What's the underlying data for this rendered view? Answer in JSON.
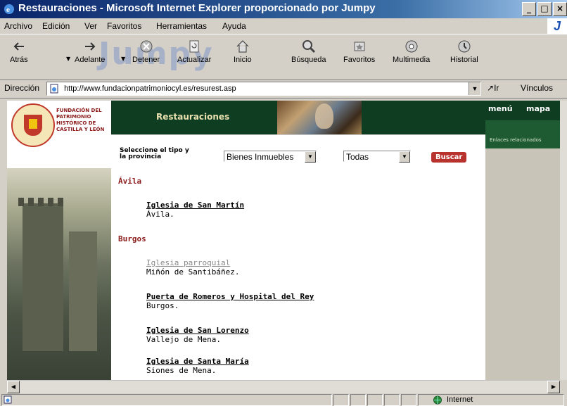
{
  "window": {
    "title": "Restauraciones - Microsoft Internet Explorer proporcionado por Jumpy"
  },
  "menu": [
    "Archivo",
    "Edición",
    "Ver",
    "Favoritos",
    "Herramientas",
    "Ayuda"
  ],
  "brand_logo": "J",
  "toolbar": {
    "watermark": "Jumpy",
    "buttons": [
      {
        "label": "Atrás",
        "icon": "back-arrow-icon"
      },
      {
        "label": "Adelante",
        "icon": "forward-arrow-icon"
      },
      {
        "label": "Detener",
        "icon": "stop-icon"
      },
      {
        "label": "Actualizar",
        "icon": "refresh-icon"
      },
      {
        "label": "Inicio",
        "icon": "home-icon"
      },
      {
        "label": "Búsqueda",
        "icon": "search-icon"
      },
      {
        "label": "Favoritos",
        "icon": "favorites-icon"
      },
      {
        "label": "Multimedia",
        "icon": "media-icon"
      },
      {
        "label": "Historial",
        "icon": "history-icon"
      }
    ]
  },
  "address": {
    "label": "Dirección",
    "url": "http://www.fundacionpatrimoniocyl.es/resurest.asp",
    "go": "Ir",
    "links": "Vínculos"
  },
  "page": {
    "org_name": "FUNDACIÓN DEL PATRIMONIO HISTÓRICO DE CASTILLA Y LEÓN",
    "title": "Restauraciones",
    "nav": {
      "menu": "menú",
      "map": "mapa",
      "related": "Enlaces relacionados"
    },
    "form": {
      "label": "Seleccione el tipo y la provincia",
      "type_value": "Bienes Inmuebles",
      "province_value": "Todas",
      "search_button": "Buscar"
    },
    "sections": [
      {
        "province": "Ávila",
        "items": [
          {
            "title": "Iglesia de San Martín",
            "place": "Ávila.",
            "visited": false
          }
        ]
      },
      {
        "province": "Burgos",
        "items": [
          {
            "title": "Iglesia parroquial",
            "place": "Miñón de Santibáñez.",
            "visited": true
          },
          {
            "title": "Puerta de Romeros y Hospital del Rey",
            "place": "Burgos.",
            "visited": false
          },
          {
            "title": "Iglesia de San Lorenzo",
            "place": "Vallejo de Mena.",
            "visited": false
          },
          {
            "title": "Iglesia de Santa María",
            "place": "Siones de Mena.",
            "visited": false
          }
        ]
      }
    ]
  },
  "status": {
    "zone": "Internet"
  }
}
